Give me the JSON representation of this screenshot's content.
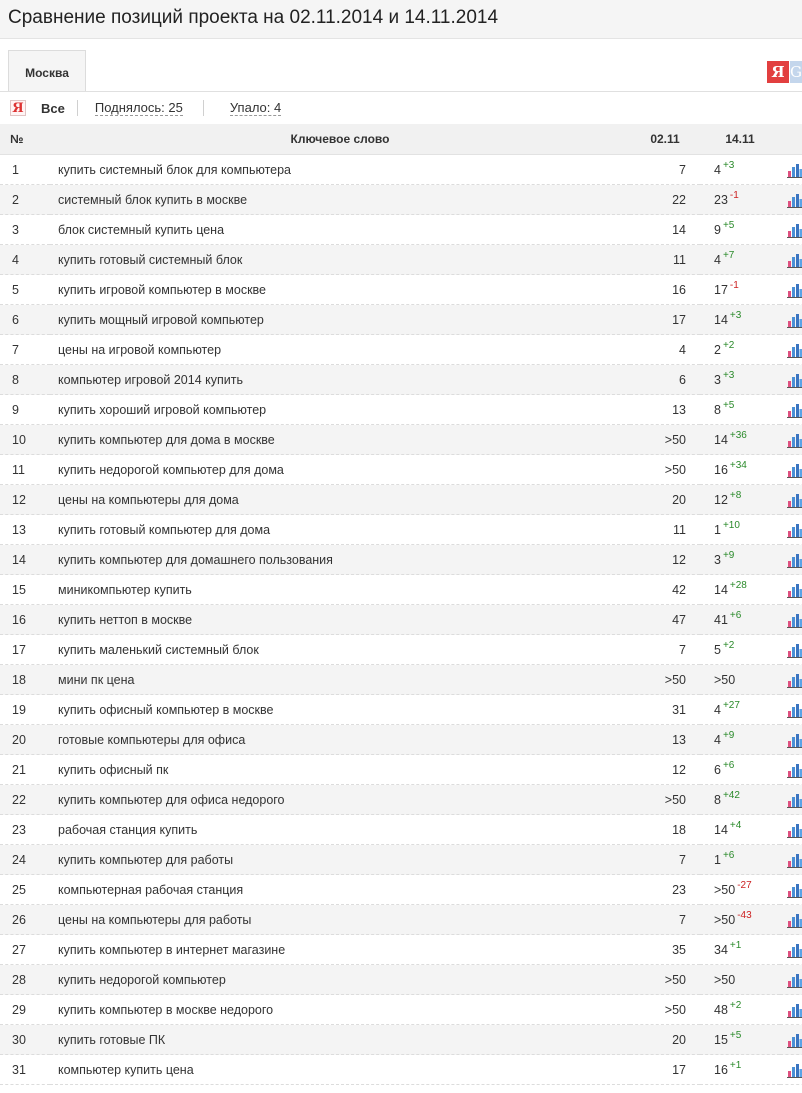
{
  "page": {
    "title": "Сравнение позиций проекта на 02.11.2014 и 14.11.2014"
  },
  "tabs": [
    {
      "label": "Москва",
      "active": true
    }
  ],
  "engines": {
    "yandex": "Я",
    "google": "G"
  },
  "filters": {
    "all": "Все",
    "up": "Поднялось: 25",
    "down": "Упало: 4"
  },
  "colors": {
    "up": "#2a8a2a",
    "down": "#cc2222",
    "row_alt": "#f4f4f4",
    "header_bg": "#f1f1f1"
  },
  "table": {
    "headers": {
      "num": "№",
      "keyword": "Ключевое слово",
      "date1": "02.11",
      "date2": "14.11"
    },
    "rows": [
      {
        "num": "1",
        "keyword": "купить системный блок для компьютера",
        "pos1": "7",
        "pos2": "4",
        "delta": "+3"
      },
      {
        "num": "2",
        "keyword": "системный блок купить в москве",
        "pos1": "22",
        "pos2": "23",
        "delta": "-1"
      },
      {
        "num": "3",
        "keyword": "блок системный купить цена",
        "pos1": "14",
        "pos2": "9",
        "delta": "+5"
      },
      {
        "num": "4",
        "keyword": "купить готовый системный блок",
        "pos1": "11",
        "pos2": "4",
        "delta": "+7"
      },
      {
        "num": "5",
        "keyword": "купить игровой компьютер в москве",
        "pos1": "16",
        "pos2": "17",
        "delta": "-1"
      },
      {
        "num": "6",
        "keyword": "купить мощный игровой компьютер",
        "pos1": "17",
        "pos2": "14",
        "delta": "+3"
      },
      {
        "num": "7",
        "keyword": "цены на игровой компьютер",
        "pos1": "4",
        "pos2": "2",
        "delta": "+2"
      },
      {
        "num": "8",
        "keyword": "компьютер игровой 2014 купить",
        "pos1": "6",
        "pos2": "3",
        "delta": "+3"
      },
      {
        "num": "9",
        "keyword": "купить хороший игровой компьютер",
        "pos1": "13",
        "pos2": "8",
        "delta": "+5"
      },
      {
        "num": "10",
        "keyword": "купить компьютер для дома в москве",
        "pos1": ">50",
        "pos2": "14",
        "delta": "+36"
      },
      {
        "num": "11",
        "keyword": "купить недорогой компьютер для дома",
        "pos1": ">50",
        "pos2": "16",
        "delta": "+34"
      },
      {
        "num": "12",
        "keyword": "цены на компьютеры для дома",
        "pos1": "20",
        "pos2": "12",
        "delta": "+8"
      },
      {
        "num": "13",
        "keyword": "купить готовый компьютер для дома",
        "pos1": "11",
        "pos2": "1",
        "delta": "+10"
      },
      {
        "num": "14",
        "keyword": "купить компьютер для домашнего пользования",
        "pos1": "12",
        "pos2": "3",
        "delta": "+9"
      },
      {
        "num": "15",
        "keyword": "миникомпьютер купить",
        "pos1": "42",
        "pos2": "14",
        "delta": "+28"
      },
      {
        "num": "16",
        "keyword": "купить неттоп в москве",
        "pos1": "47",
        "pos2": "41",
        "delta": "+6"
      },
      {
        "num": "17",
        "keyword": "купить маленький системный блок",
        "pos1": "7",
        "pos2": "5",
        "delta": "+2"
      },
      {
        "num": "18",
        "keyword": "мини пк цена",
        "pos1": ">50",
        "pos2": ">50",
        "delta": ""
      },
      {
        "num": "19",
        "keyword": "купить офисный компьютер в москве",
        "pos1": "31",
        "pos2": "4",
        "delta": "+27"
      },
      {
        "num": "20",
        "keyword": "готовые компьютеры для офиса",
        "pos1": "13",
        "pos2": "4",
        "delta": "+9"
      },
      {
        "num": "21",
        "keyword": "купить офисный пк",
        "pos1": "12",
        "pos2": "6",
        "delta": "+6"
      },
      {
        "num": "22",
        "keyword": "купить компьютер для офиса недорого",
        "pos1": ">50",
        "pos2": "8",
        "delta": "+42"
      },
      {
        "num": "23",
        "keyword": "рабочая станция купить",
        "pos1": "18",
        "pos2": "14",
        "delta": "+4"
      },
      {
        "num": "24",
        "keyword": "купить компьютер для работы",
        "pos1": "7",
        "pos2": "1",
        "delta": "+6"
      },
      {
        "num": "25",
        "keyword": "компьютерная рабочая станция",
        "pos1": "23",
        "pos2": ">50",
        "delta": "-27"
      },
      {
        "num": "26",
        "keyword": "цены на компьютеры для работы",
        "pos1": "7",
        "pos2": ">50",
        "delta": "-43"
      },
      {
        "num": "27",
        "keyword": "купить компьютер в интернет магазине",
        "pos1": "35",
        "pos2": "34",
        "delta": "+1"
      },
      {
        "num": "28",
        "keyword": "купить недорогой компьютер",
        "pos1": ">50",
        "pos2": ">50",
        "delta": ""
      },
      {
        "num": "29",
        "keyword": "купить компьютер в москве недорого",
        "pos1": ">50",
        "pos2": "48",
        "delta": "+2"
      },
      {
        "num": "30",
        "keyword": "купить готовые ПК",
        "pos1": "20",
        "pos2": "15",
        "delta": "+5"
      },
      {
        "num": "31",
        "keyword": "компьютер купить цена",
        "pos1": "17",
        "pos2": "16",
        "delta": "+1"
      }
    ]
  }
}
